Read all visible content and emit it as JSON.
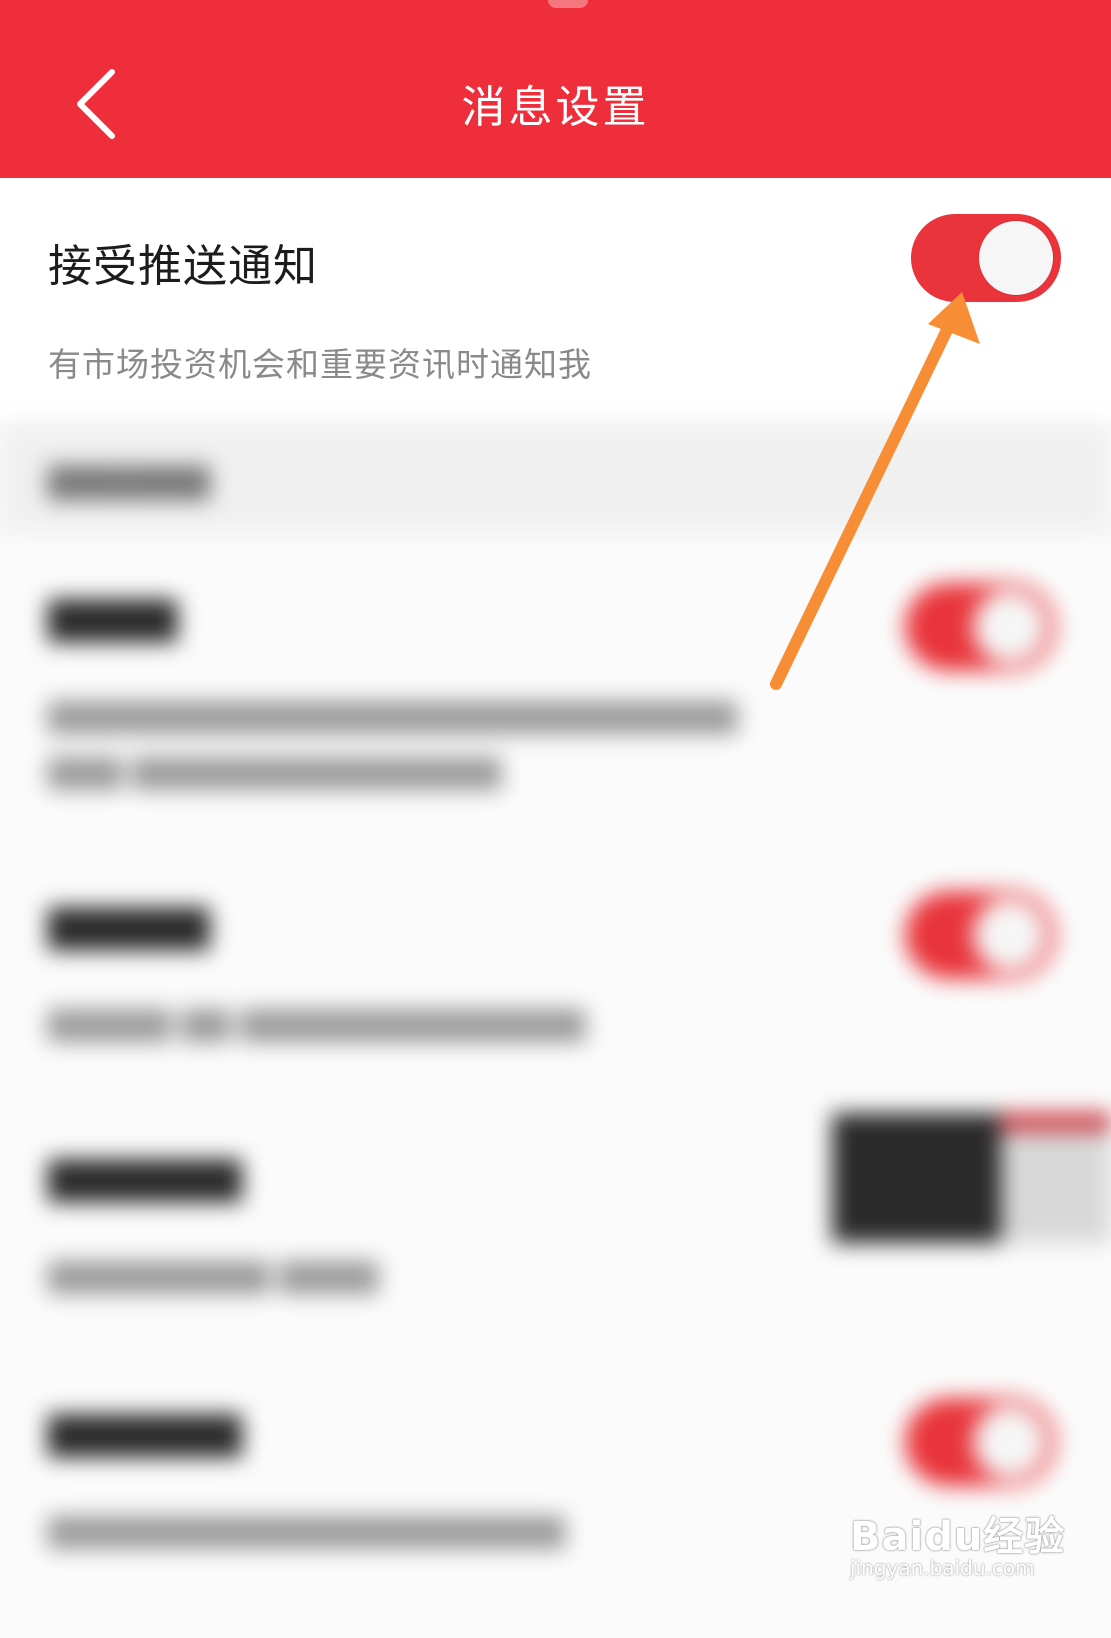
{
  "header": {
    "title": "消息设置",
    "back_icon": "chevron-left-icon",
    "background": "#ef2e3b"
  },
  "push": {
    "title": "接受推送通知",
    "description": "有市场投资机会和重要资讯时通知我",
    "enabled": true
  },
  "colors": {
    "accent": "#ef2e3b",
    "toggle_on": "#e8343a",
    "arrow": "#f78d34"
  },
  "watermark": {
    "brand": "Baidu经验",
    "url": "jingyan.baidu.com"
  }
}
